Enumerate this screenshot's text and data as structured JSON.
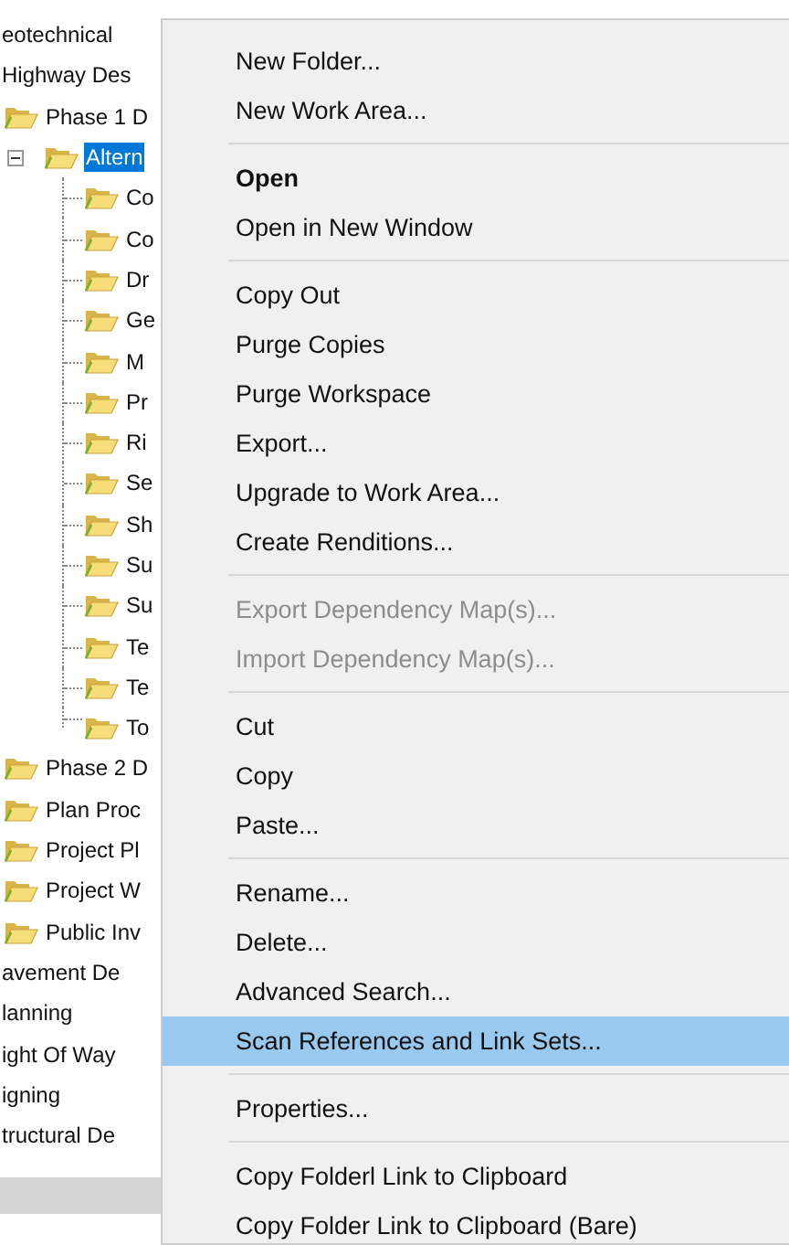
{
  "tree": [
    {
      "label": "eotechnical",
      "selected": false
    },
    {
      "label": "Highway Des",
      "selected": false,
      "children": [
        {
          "label": "Phase 1 D",
          "selected": false,
          "children": [
            {
              "label": "Altern",
              "selected": true,
              "expanded": true,
              "children": [
                {
                  "label": "Co",
                  "selected": false
                },
                {
                  "label": "Co",
                  "selected": false
                },
                {
                  "label": "Dr",
                  "selected": false
                },
                {
                  "label": "Ge",
                  "selected": false
                },
                {
                  "label": "M",
                  "selected": false
                },
                {
                  "label": "Pr",
                  "selected": false
                },
                {
                  "label": "Ri",
                  "selected": false
                },
                {
                  "label": "Se",
                  "selected": false
                },
                {
                  "label": "Sh",
                  "selected": false
                },
                {
                  "label": "Su",
                  "selected": false
                },
                {
                  "label": "Su",
                  "selected": false
                },
                {
                  "label": "Te",
                  "selected": false
                },
                {
                  "label": "Te",
                  "selected": false
                },
                {
                  "label": "To",
                  "selected": false
                }
              ]
            }
          ]
        },
        {
          "label": "Phase 2 D",
          "selected": false
        },
        {
          "label": "Plan Proc",
          "selected": false
        },
        {
          "label": "Project Pl",
          "selected": false
        },
        {
          "label": "Project W",
          "selected": false
        },
        {
          "label": "Public Inv",
          "selected": false
        }
      ]
    },
    {
      "label": "avement De",
      "selected": false
    },
    {
      "label": "lanning",
      "selected": false
    },
    {
      "label": "ight Of Way",
      "selected": false
    },
    {
      "label": "igning",
      "selected": false
    },
    {
      "label": "tructural De",
      "selected": false
    }
  ],
  "context_menu": [
    {
      "kind": "item",
      "label": "New Folder...",
      "default": false,
      "disabled": false,
      "selected": false
    },
    {
      "kind": "item",
      "label": "New Work Area...",
      "default": false,
      "disabled": false,
      "selected": false
    },
    {
      "kind": "separator"
    },
    {
      "kind": "item",
      "label": "Open",
      "default": true,
      "disabled": false,
      "selected": false
    },
    {
      "kind": "item",
      "label": "Open in New Window",
      "default": false,
      "disabled": false,
      "selected": false
    },
    {
      "kind": "separator"
    },
    {
      "kind": "item",
      "label": "Copy Out",
      "default": false,
      "disabled": false,
      "selected": false
    },
    {
      "kind": "item",
      "label": "Purge Copies",
      "default": false,
      "disabled": false,
      "selected": false
    },
    {
      "kind": "item",
      "label": "Purge Workspace",
      "default": false,
      "disabled": false,
      "selected": false
    },
    {
      "kind": "item",
      "label": "Export...",
      "default": false,
      "disabled": false,
      "selected": false
    },
    {
      "kind": "item",
      "label": "Upgrade to Work Area...",
      "default": false,
      "disabled": false,
      "selected": false
    },
    {
      "kind": "item",
      "label": "Create Renditions...",
      "default": false,
      "disabled": false,
      "selected": false
    },
    {
      "kind": "separator"
    },
    {
      "kind": "item",
      "label": "Export Dependency Map(s)...",
      "default": false,
      "disabled": true,
      "selected": false
    },
    {
      "kind": "item",
      "label": "Import Dependency Map(s)...",
      "default": false,
      "disabled": true,
      "selected": false
    },
    {
      "kind": "separator"
    },
    {
      "kind": "item",
      "label": "Cut",
      "default": false,
      "disabled": false,
      "selected": false
    },
    {
      "kind": "item",
      "label": "Copy",
      "default": false,
      "disabled": false,
      "selected": false
    },
    {
      "kind": "item",
      "label": "Paste...",
      "default": false,
      "disabled": false,
      "selected": false
    },
    {
      "kind": "separator"
    },
    {
      "kind": "item",
      "label": "Rename...",
      "default": false,
      "disabled": false,
      "selected": false
    },
    {
      "kind": "item",
      "label": "Delete...",
      "default": false,
      "disabled": false,
      "selected": false
    },
    {
      "kind": "item",
      "label": "Advanced Search...",
      "default": false,
      "disabled": false,
      "selected": false
    },
    {
      "kind": "item",
      "label": "Scan References and Link Sets...",
      "default": false,
      "disabled": false,
      "selected": true
    },
    {
      "kind": "separator"
    },
    {
      "kind": "item",
      "label": "Properties...",
      "default": false,
      "disabled": false,
      "selected": false
    },
    {
      "kind": "separator"
    },
    {
      "kind": "item",
      "label": "Copy Folderl Link to Clipboard",
      "default": false,
      "disabled": false,
      "selected": false
    },
    {
      "kind": "item",
      "label": "Copy Folder Link to Clipboard (Bare)",
      "default": false,
      "disabled": false,
      "selected": false
    }
  ]
}
